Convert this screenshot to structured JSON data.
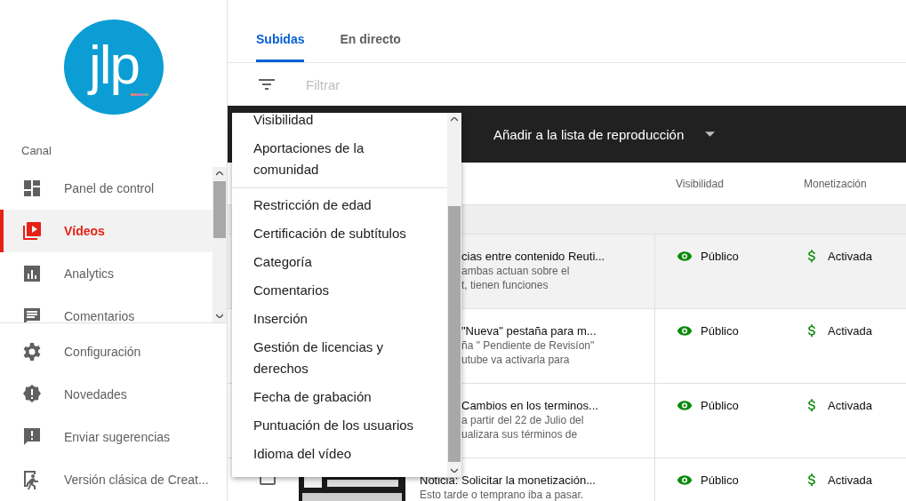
{
  "sidebar": {
    "logo_text": "jlp",
    "section_label": "Canal",
    "items": [
      {
        "label": "Panel de control",
        "kind": "dashboard",
        "selected": false
      },
      {
        "label": "Vídeos",
        "kind": "video",
        "selected": true
      },
      {
        "label": "Analytics",
        "kind": "analytics",
        "selected": false
      },
      {
        "label": "Comentarios",
        "kind": "comment",
        "selected": false
      }
    ],
    "footer_items": [
      {
        "label": "Configuración",
        "kind": "gear"
      },
      {
        "label": "Novedades",
        "kind": "alert"
      },
      {
        "label": "Enviar sugerencias",
        "kind": "feedback"
      },
      {
        "label": "Versión clásica de Creat...",
        "kind": "exit"
      }
    ]
  },
  "tabs": [
    {
      "label": "Subidas",
      "selected": true
    },
    {
      "label": "En directo",
      "selected": false
    }
  ],
  "filter": {
    "placeholder": "Filtrar"
  },
  "action_bar": {
    "label": "Añadir a la lista de reproducción"
  },
  "columns": [
    "Visibilidad",
    "Monetización"
  ],
  "rows": [
    {
      "title": "cias entre contenido Reuti...",
      "description": [
        "ambas actuan sobre el",
        "t, tienen funciones"
      ],
      "visibility": "Público",
      "monetization": "Activada",
      "highlighted": true,
      "thumbnail_visible": false
    },
    {
      "title": "\"Nueva\" pestaña para m...",
      "description": [
        "ña \" Pendiente de Revisíon\"",
        "utube va activarla para"
      ],
      "visibility": "Público",
      "monetization": "Activada",
      "highlighted": false,
      "thumbnail_visible": false
    },
    {
      "title": "Cambios en los terminos...",
      "description": [
        "a partir del 22 de Julio del",
        "ualizara sus términos de"
      ],
      "visibility": "Público",
      "monetization": "Activada",
      "highlighted": false,
      "thumbnail_visible": false
    },
    {
      "title": "Noticia: Solicitar la monetización...",
      "description": [
        "Esto tarde o temprano iba a pasar."
      ],
      "visibility": "Público",
      "monetization": "Activada",
      "highlighted": false,
      "thumbnail_visible": true
    }
  ],
  "dropdown": {
    "groups": [
      [
        "Visibilidad",
        "Aportaciones de la comunidad"
      ],
      [
        "Restricción de edad",
        "Certificación de subtítulos",
        "Categoría",
        "Comentarios",
        "Inserción",
        "Gestión de licencias y derechos",
        "Fecha de grabación",
        "Puntuación de los usuarios",
        "Idioma del vídeo"
      ]
    ]
  }
}
